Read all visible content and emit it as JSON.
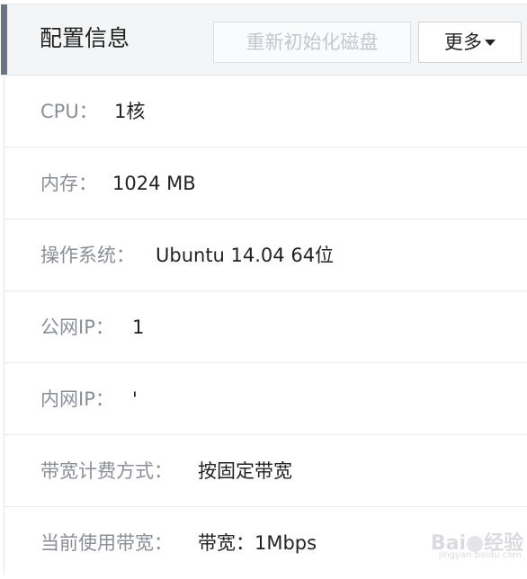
{
  "header": {
    "title": "配置信息",
    "reinit_button": "重新初始化磁盘",
    "more_button": "更多"
  },
  "rows": [
    {
      "label": "CPU：",
      "value": "1核"
    },
    {
      "label": "内存：",
      "value": "1024 MB"
    },
    {
      "label": "操作系统：",
      "value": "Ubuntu 14.04 64位"
    },
    {
      "label": "公网IP：",
      "value": "1"
    },
    {
      "label": "内网IP：",
      "value": "'"
    },
    {
      "label": "带宽计费方式：",
      "value": "按固定带宽"
    },
    {
      "label": "当前使用带宽：",
      "value": "带宽：1Mbps"
    }
  ],
  "watermark": {
    "text_left": "Bai",
    "text_right": "经验",
    "sub": "jingyan.baidu.com"
  },
  "colors": {
    "accent": "#6d7480",
    "label": "#8a8f97",
    "value": "#222222",
    "disabled": "#c3c7cd"
  }
}
